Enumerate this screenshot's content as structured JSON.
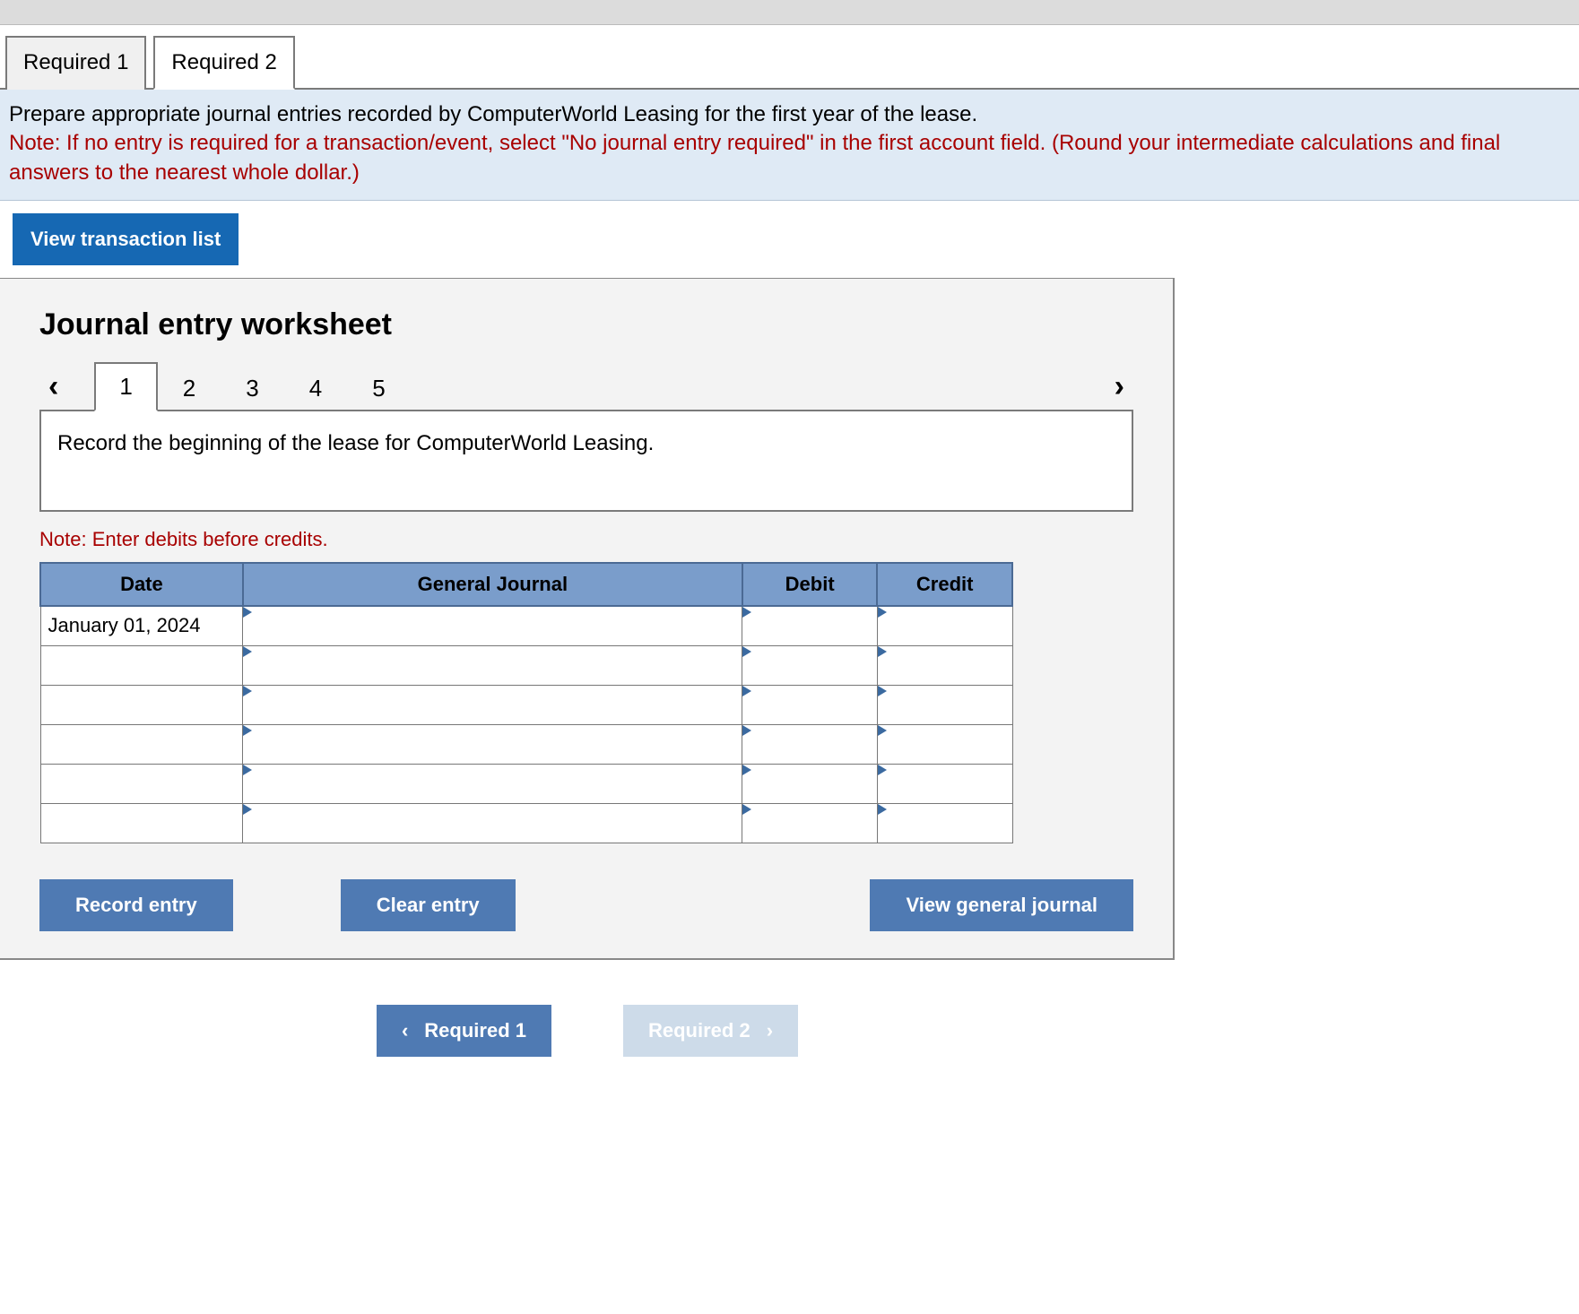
{
  "tabs": {
    "req1": "Required 1",
    "req2": "Required 2",
    "activeIndex": 1
  },
  "instructions": {
    "main": "Prepare appropriate journal entries recorded by ComputerWorld Leasing for the first year of the lease.",
    "note": "Note: If no entry is required for a transaction/event, select \"No journal entry required\" in the first account field. (Round your intermediate calculations and final answers to the nearest whole dollar.)"
  },
  "buttons": {
    "viewTransactionList": "View transaction list",
    "recordEntry": "Record entry",
    "clearEntry": "Clear entry",
    "viewGeneralJournal": "View general journal",
    "prevRequired": "Required 1",
    "nextRequired": "Required 2"
  },
  "worksheet": {
    "title": "Journal entry worksheet",
    "pages": {
      "p1": "1",
      "p2": "2",
      "p3": "3",
      "p4": "4",
      "p5": "5"
    },
    "activePage": 1,
    "entryDescription": "Record the beginning of the lease for ComputerWorld Leasing.",
    "noteDebits": "Note: Enter debits before credits.",
    "headers": {
      "date": "Date",
      "generalJournal": "General Journal",
      "debit": "Debit",
      "credit": "Credit"
    },
    "rows": [
      {
        "date": "January 01, 2024",
        "gj": "",
        "debit": "",
        "credit": ""
      },
      {
        "date": "",
        "gj": "",
        "debit": "",
        "credit": ""
      },
      {
        "date": "",
        "gj": "",
        "debit": "",
        "credit": ""
      },
      {
        "date": "",
        "gj": "",
        "debit": "",
        "credit": ""
      },
      {
        "date": "",
        "gj": "",
        "debit": "",
        "credit": ""
      },
      {
        "date": "",
        "gj": "",
        "debit": "",
        "credit": ""
      }
    ]
  }
}
